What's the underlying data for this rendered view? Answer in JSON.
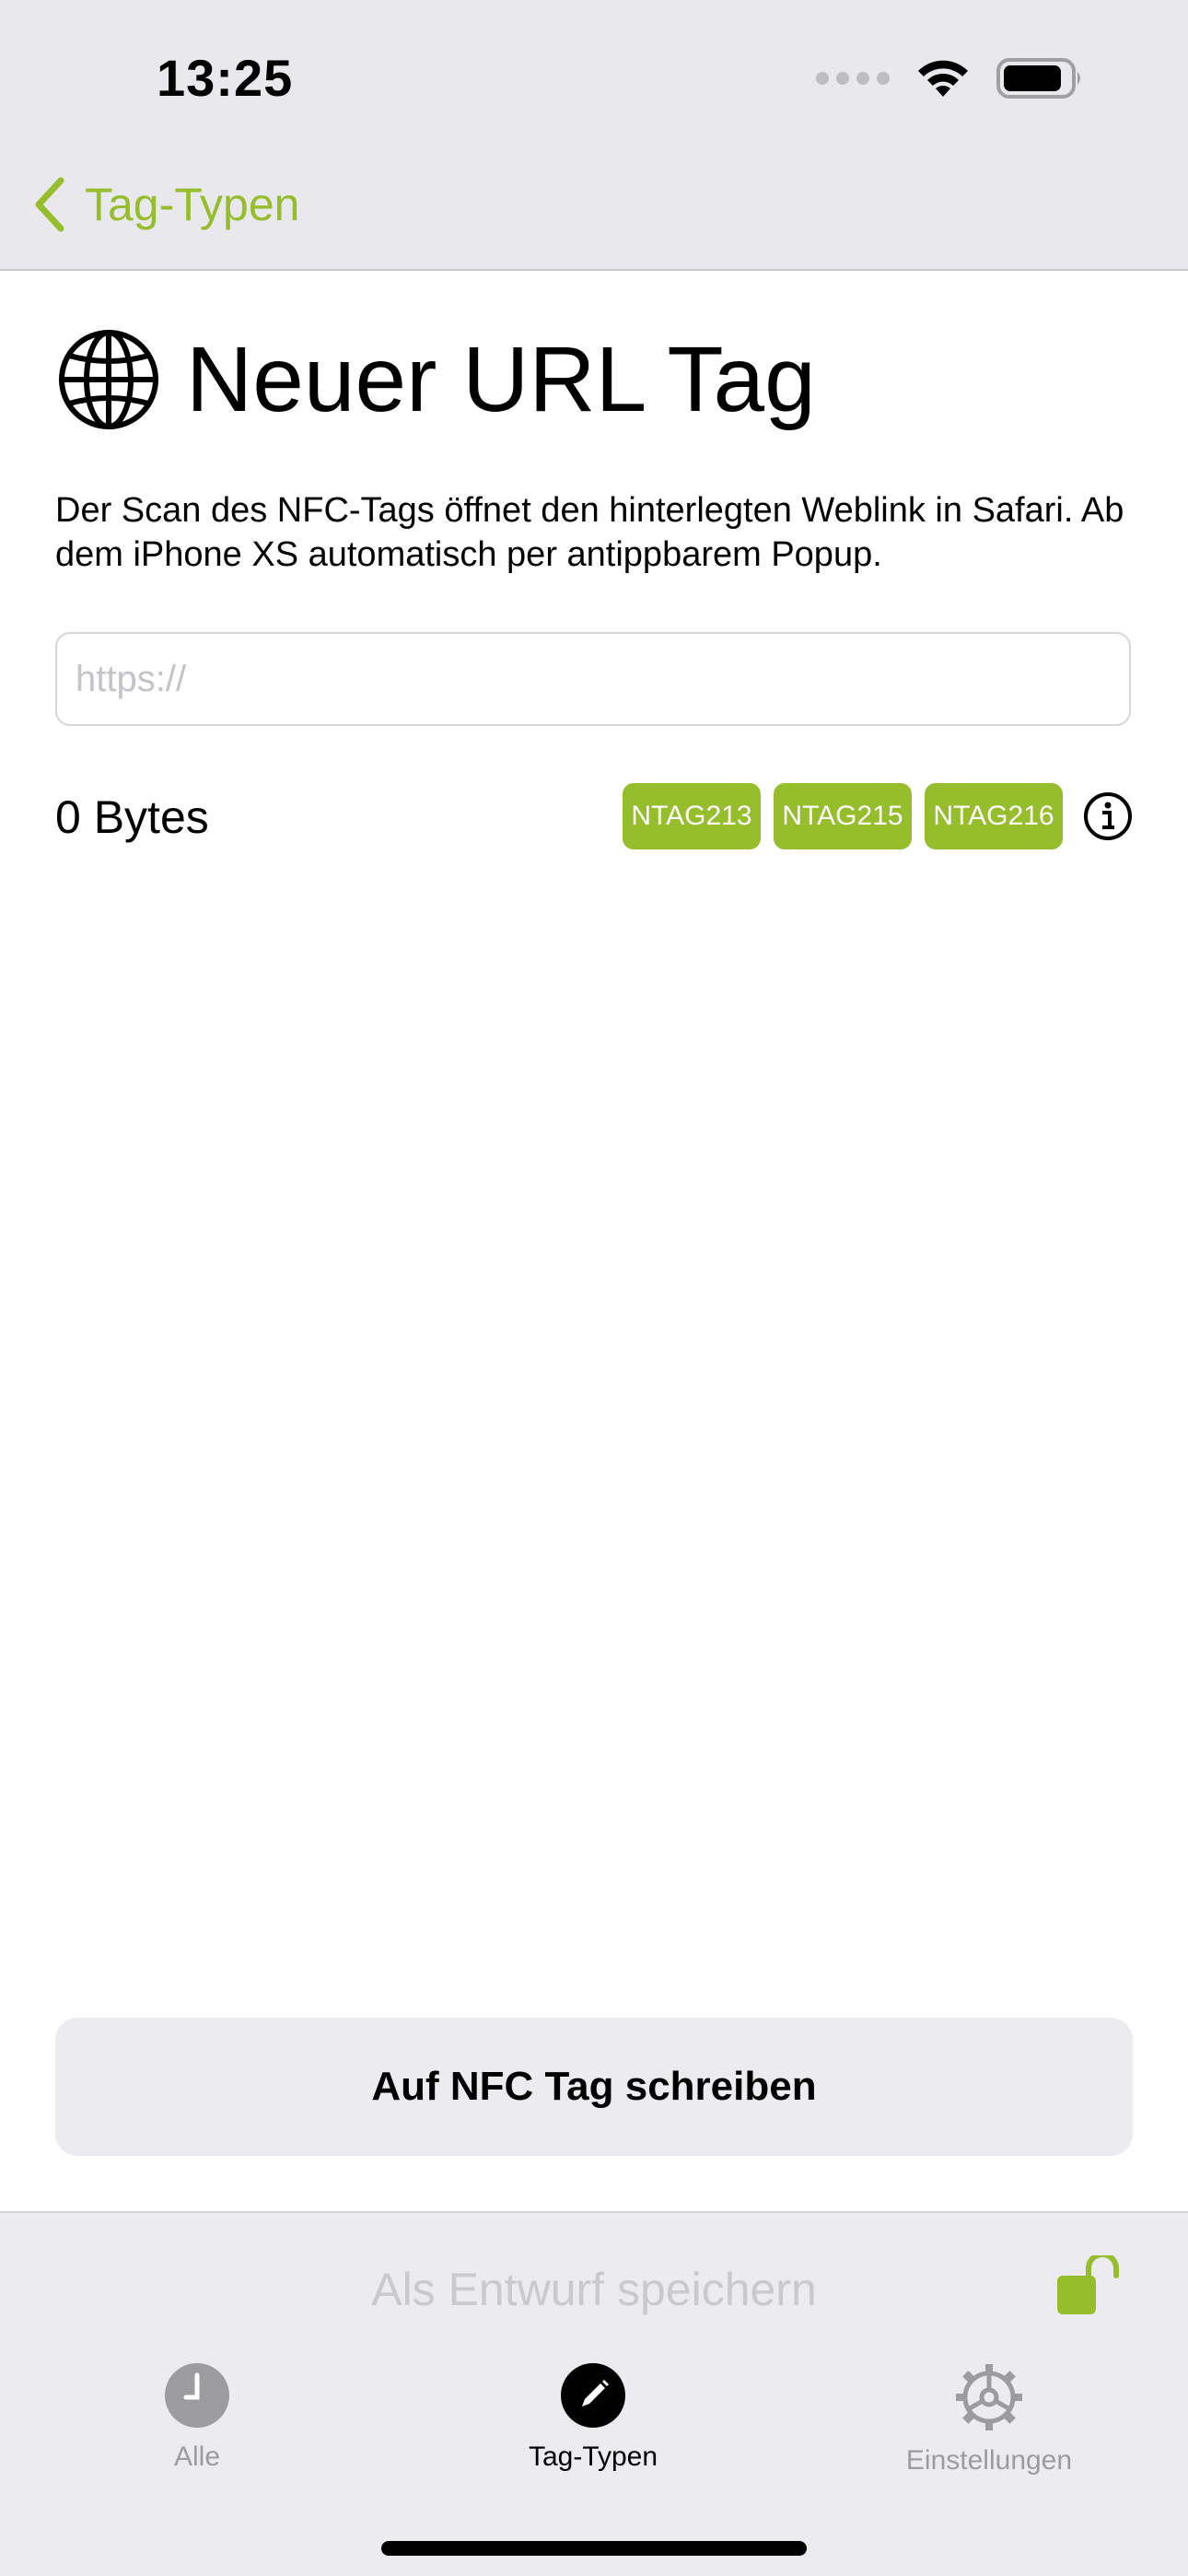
{
  "status_bar": {
    "time": "13:25"
  },
  "nav": {
    "back_label": "Tag-Typen"
  },
  "header": {
    "icon": "globe-icon",
    "title": "Neuer URL Tag"
  },
  "description": "Der Scan des NFC-Tags öffnet den hinterlegten Weblink in Safari. Ab dem iPhone XS automatisch per antippbarem Popup.",
  "url_field": {
    "value": "",
    "placeholder": "https://"
  },
  "size": {
    "label": "0 Bytes"
  },
  "tag_chips": [
    "NTAG213",
    "NTAG215",
    "NTAG216"
  ],
  "write_button_label": "Auf NFC Tag schreiben",
  "draft_label": "Als Entwurf speichern",
  "tabs": [
    {
      "label": "Alle",
      "icon": "clock-icon",
      "active": false
    },
    {
      "label": "Tag-Typen",
      "icon": "pencil-icon",
      "active": true
    },
    {
      "label": "Einstellungen",
      "icon": "gear-icon",
      "active": false
    }
  ],
  "colors": {
    "accent": "#96bd2b",
    "top_background": "#e9e9ed",
    "inactive_tab": "#9c9ca0"
  }
}
